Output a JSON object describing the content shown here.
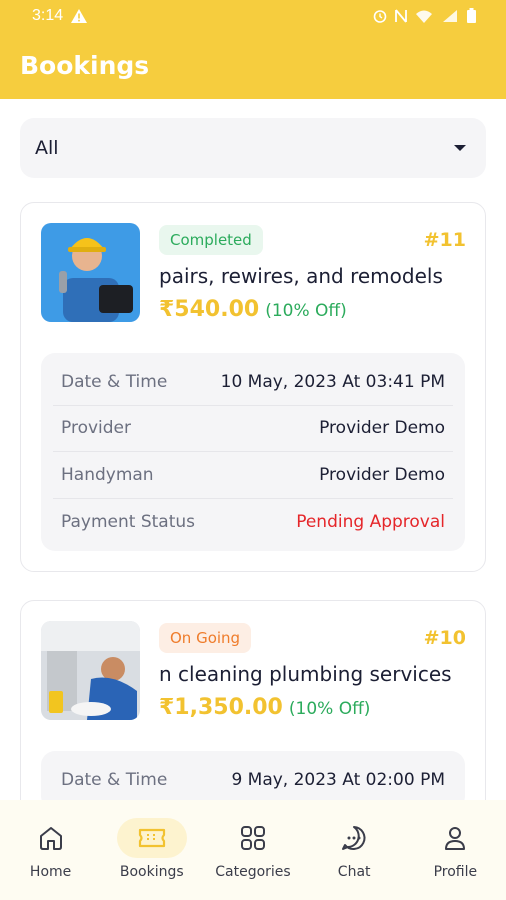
{
  "status_bar": {
    "time": "3:14"
  },
  "header": {
    "title": "Bookings"
  },
  "filter": {
    "value": "All"
  },
  "bookings": [
    {
      "status": "Completed",
      "id": "#11",
      "title": "pairs, rewires, and remodels",
      "price": "₹540.00",
      "discount": "(10% Off)",
      "details": [
        {
          "label": "Date & Time",
          "value": "10 May, 2023 At 03:41 PM"
        },
        {
          "label": "Provider",
          "value": "Provider Demo"
        },
        {
          "label": "Handyman",
          "value": "Provider Demo"
        },
        {
          "label": "Payment Status",
          "value": "Pending Approval"
        }
      ]
    },
    {
      "status": "On Going",
      "id": "#10",
      "title": "n cleaning plumbing services",
      "price": "₹1,350.00",
      "discount": "(10% Off)",
      "details": [
        {
          "label": "Date & Time",
          "value": "9 May, 2023 At 02:00 PM"
        }
      ]
    }
  ],
  "nav": [
    {
      "label": "Home",
      "icon": "home-icon"
    },
    {
      "label": "Bookings",
      "icon": "ticket-icon"
    },
    {
      "label": "Categories",
      "icon": "grid-icon"
    },
    {
      "label": "Chat",
      "icon": "chat-icon"
    },
    {
      "label": "Profile",
      "icon": "profile-icon"
    }
  ],
  "colors": {
    "brand": "#f6cd3e",
    "price": "#f2c230",
    "success": "#2cab5c",
    "ongoing": "#ef7c2b",
    "error": "#e5262a"
  }
}
